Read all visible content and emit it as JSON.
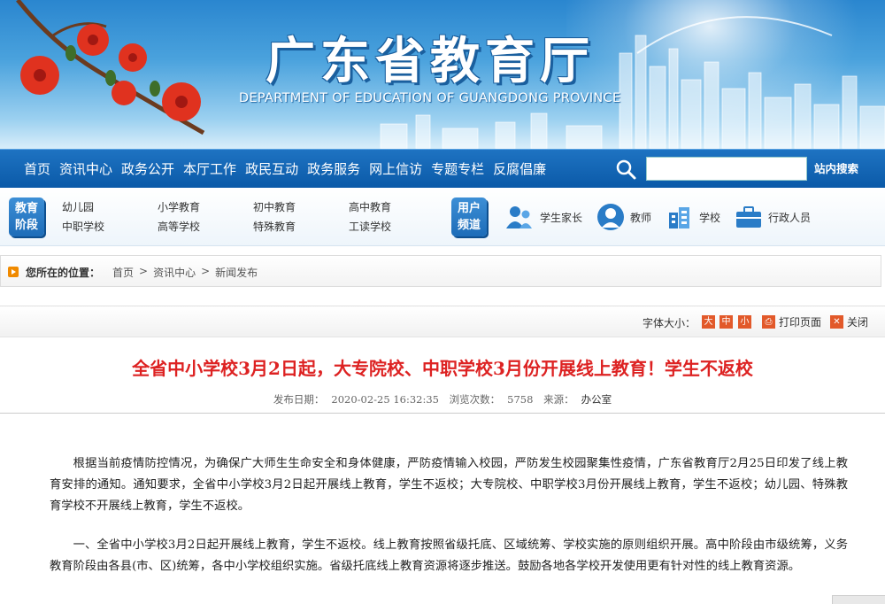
{
  "banner": {
    "title": "广东省教育厅",
    "subtitle": "DEPARTMENT OF EDUCATION OF GUANGDONG PROVINCE"
  },
  "nav": {
    "items": [
      "首页",
      "资讯中心",
      "政务公开",
      "本厅工作",
      "政民互动",
      "政务服务",
      "网上信访",
      "专题专栏",
      "反腐倡廉"
    ],
    "search_placeholder": "",
    "search_button": "站内搜索"
  },
  "stages": {
    "badge": "教育阶段",
    "links": [
      "幼儿园",
      "小学教育",
      "初中教育",
      "高中教育",
      "中职学校",
      "高等学校",
      "特殊教育",
      "工读学校"
    ]
  },
  "user_channel": {
    "badge": "用户频道",
    "items": [
      {
        "label": "学生家长",
        "icon": "parent-student-icon"
      },
      {
        "label": "教师",
        "icon": "teacher-icon"
      },
      {
        "label": "学校",
        "icon": "school-building-icon"
      },
      {
        "label": "行政人员",
        "icon": "briefcase-icon"
      }
    ]
  },
  "breadcrumb": {
    "label": "您所在的位置：",
    "items": [
      "首页",
      "资讯中心",
      "新闻发布"
    ],
    "sep": ">"
  },
  "tools": {
    "font_size_label": "字体大小：",
    "sizes": [
      "大",
      "中",
      "小"
    ],
    "print": "打印页面",
    "close": "关闭"
  },
  "article": {
    "title": "全省中小学校3月2日起，大专院校、中职学校3月份开展线上教育！学生不返校",
    "date_label": "发布日期：",
    "date": "2020-02-25 16:32:35",
    "views_label": "浏览次数：",
    "views": "5758",
    "source_label": "来源：",
    "source": "办公室",
    "paragraphs": [
      "根据当前疫情防控情况，为确保广大师生生命安全和身体健康，严防疫情输入校园，严防发生校园聚集性疫情，广东省教育厅2月25日印发了线上教育安排的通知。通知要求，全省中小学校3月2日起开展线上教育，学生不返校；大专院校、中职学校3月份开展线上教育，学生不返校；幼儿园、特殊教育学校不开展线上教育，学生不返校。",
      "一、全省中小学校3月2日起开展线上教育，学生不返校。线上教育按照省级托底、区域统筹、学校实施的原则组织开展。高中阶段由市级统筹，义务教育阶段由各县(市、区)统筹，各中小学校组织实施。省级托底线上教育资源将逐步推送。鼓励各地各学校开发使用更有针对性的线上教育资源。"
    ]
  },
  "colors": {
    "nav_bg": "#0b5aa8",
    "title_red": "#dd2222",
    "accent_orange": "#e2592a"
  }
}
